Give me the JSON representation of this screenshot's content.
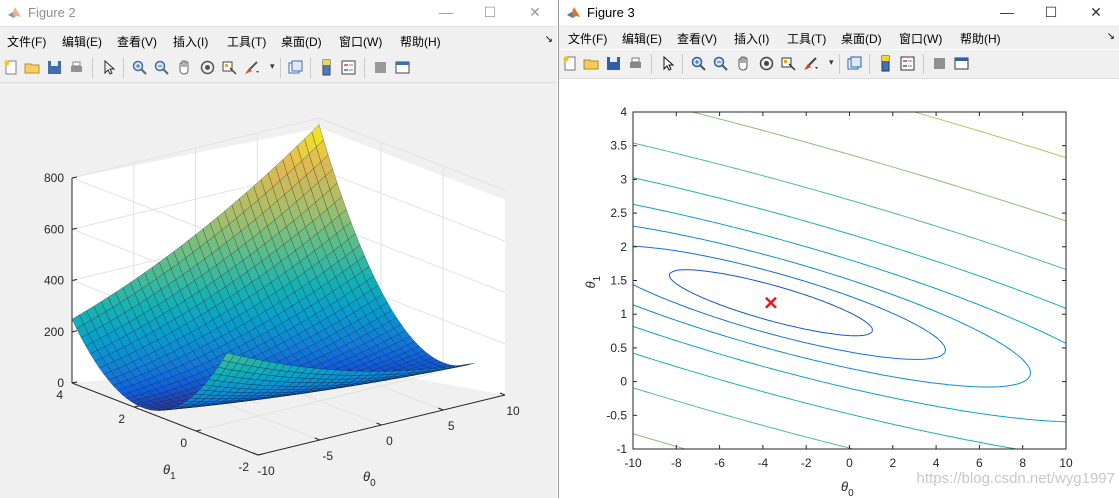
{
  "figure2": {
    "title": "Figure 2",
    "window_controls": {
      "minimize": "—",
      "maximize": "☐",
      "close": "✕"
    },
    "menu": [
      "文件(F)",
      "编辑(E)",
      "查看(V)",
      "插入(I)",
      "工具(T)",
      "桌面(D)",
      "窗口(W)",
      "帮助(H)"
    ],
    "menu_overflow": "↘",
    "toolbar_icons": [
      "new-figure-icon",
      "open-file-icon",
      "save-icon",
      "print-icon",
      "pointer-icon",
      "zoom-in-icon",
      "zoom-out-icon",
      "pan-icon",
      "rotate-3d-icon",
      "data-cursor-icon",
      "brush-icon",
      "link-plot-icon",
      "colorbar-icon",
      "legend-icon",
      "hide-plot-tools-icon",
      "show-plot-tools-icon"
    ]
  },
  "figure3": {
    "title": "Figure 3",
    "window_controls": {
      "minimize": "—",
      "maximize": "☐",
      "close": "✕"
    },
    "menu": [
      "文件(F)",
      "编辑(E)",
      "查看(V)",
      "插入(I)",
      "工具(T)",
      "桌面(D)",
      "窗口(W)",
      "帮助(H)"
    ],
    "menu_overflow": "↘",
    "toolbar_icons": [
      "new-figure-icon",
      "open-file-icon",
      "save-icon",
      "print-icon",
      "pointer-icon",
      "zoom-in-icon",
      "zoom-out-icon",
      "pan-icon",
      "rotate-3d-icon",
      "data-cursor-icon",
      "brush-icon",
      "link-plot-icon",
      "colorbar-icon",
      "legend-icon",
      "hide-plot-tools-icon",
      "show-plot-tools-icon"
    ]
  },
  "colors": {
    "marker": "#e31a1c",
    "contour_dark": "#2b2d7a",
    "contour_mid": "#1f78c8",
    "contour_teal": "#2ca0a0",
    "contour_yellow": "#f5e020"
  },
  "watermark": "https://blog.csdn.net/wyg1997",
  "chart_data": [
    {
      "type": "surface",
      "title": "",
      "xlabel": "θ0",
      "ylabel": "θ1",
      "zlabel": "",
      "x_ticks": [
        "-10",
        "-5",
        "0",
        "5",
        "10"
      ],
      "y_ticks": [
        "-2",
        "0",
        "2",
        "4"
      ],
      "z_ticks": [
        "0",
        "200",
        "400",
        "600",
        "800"
      ],
      "xlim": [
        -10,
        10
      ],
      "ylim": [
        -1,
        4
      ],
      "zlim": [
        0,
        800
      ],
      "colormap": "parula",
      "grid": true
    },
    {
      "type": "contour",
      "title": "",
      "xlabel": "θ0",
      "ylabel": "θ1",
      "x_ticks": [
        "-10",
        "-8",
        "-6",
        "-4",
        "-2",
        "0",
        "2",
        "4",
        "6",
        "8",
        "10"
      ],
      "y_ticks": [
        "-1",
        "-0.5",
        "0",
        "0.5",
        "1",
        "1.5",
        "2",
        "2.5",
        "3",
        "3.5",
        "4"
      ],
      "xlim": [
        -10,
        10
      ],
      "ylim": [
        -1,
        4
      ],
      "levels": "logspace(-2, 3, 20)",
      "minimum_marker": {
        "x": -3.63,
        "y": 1.17,
        "symbol": "x"
      }
    }
  ]
}
